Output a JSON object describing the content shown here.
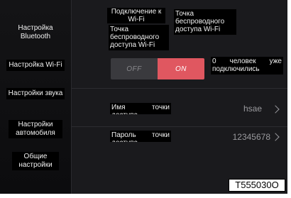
{
  "sidebar": {
    "items": [
      {
        "label": "Настройка Bluetooth"
      },
      {
        "label": "Настройка Wi-Fi"
      },
      {
        "label": "Настройки звука"
      },
      {
        "label": "Настройки автомобиля"
      },
      {
        "label": "Общие настройки"
      }
    ]
  },
  "header": {
    "tab_connect": "Подключение к Wi-Fi",
    "tab_hotspot": "Точка беспроводного доступа Wi-Fi"
  },
  "hotspot": {
    "title": "Точка беспроводного доступа Wi-Fi",
    "toggle_off": "OFF",
    "toggle_on": "ON",
    "connected_info": "0 человек уже подключились"
  },
  "rows": [
    {
      "label": "Имя точки доступа",
      "value": "hsae"
    },
    {
      "label": "Пароль точки доступа",
      "value": "12345678"
    }
  ],
  "ref_code": "T555030O",
  "colors": {
    "accent": "#e05760",
    "background": "#1a1a1d",
    "sidebar": "#0c0c0e"
  },
  "icons": {
    "row_chevron": "chevron-right-icon"
  }
}
